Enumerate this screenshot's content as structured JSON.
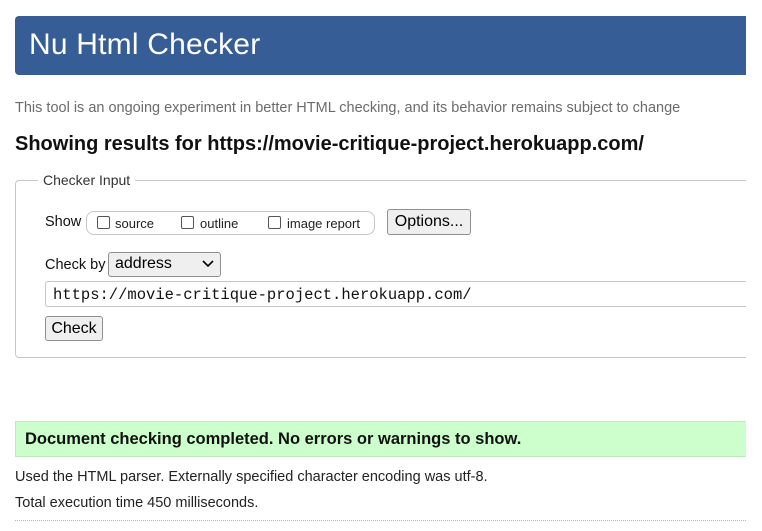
{
  "header": {
    "title": "Nu Html Checker"
  },
  "intro": "This tool is an ongoing experiment in better HTML checking, and its behavior remains subject to change",
  "results_heading": "Showing results for https://movie-critique-project.herokuapp.com/",
  "checker_input": {
    "legend": "Checker Input",
    "show_label": "Show",
    "options": [
      {
        "label": "source",
        "checked": false
      },
      {
        "label": "outline",
        "checked": false
      },
      {
        "label": "image report",
        "checked": false
      }
    ],
    "options_button": "Options...",
    "check_by_label": "Check by",
    "check_by_value": "address",
    "url_value": "https://movie-critique-project.herokuapp.com/",
    "check_button": "Check"
  },
  "result": {
    "message": "Document checking completed. No errors or warnings to show.",
    "color": "#ccffcc"
  },
  "details": {
    "parser": "Used the HTML parser. Externally specified character encoding was utf-8.",
    "time": "Total execution time 450 milliseconds."
  },
  "colors": {
    "header_bg": "#365d95"
  }
}
